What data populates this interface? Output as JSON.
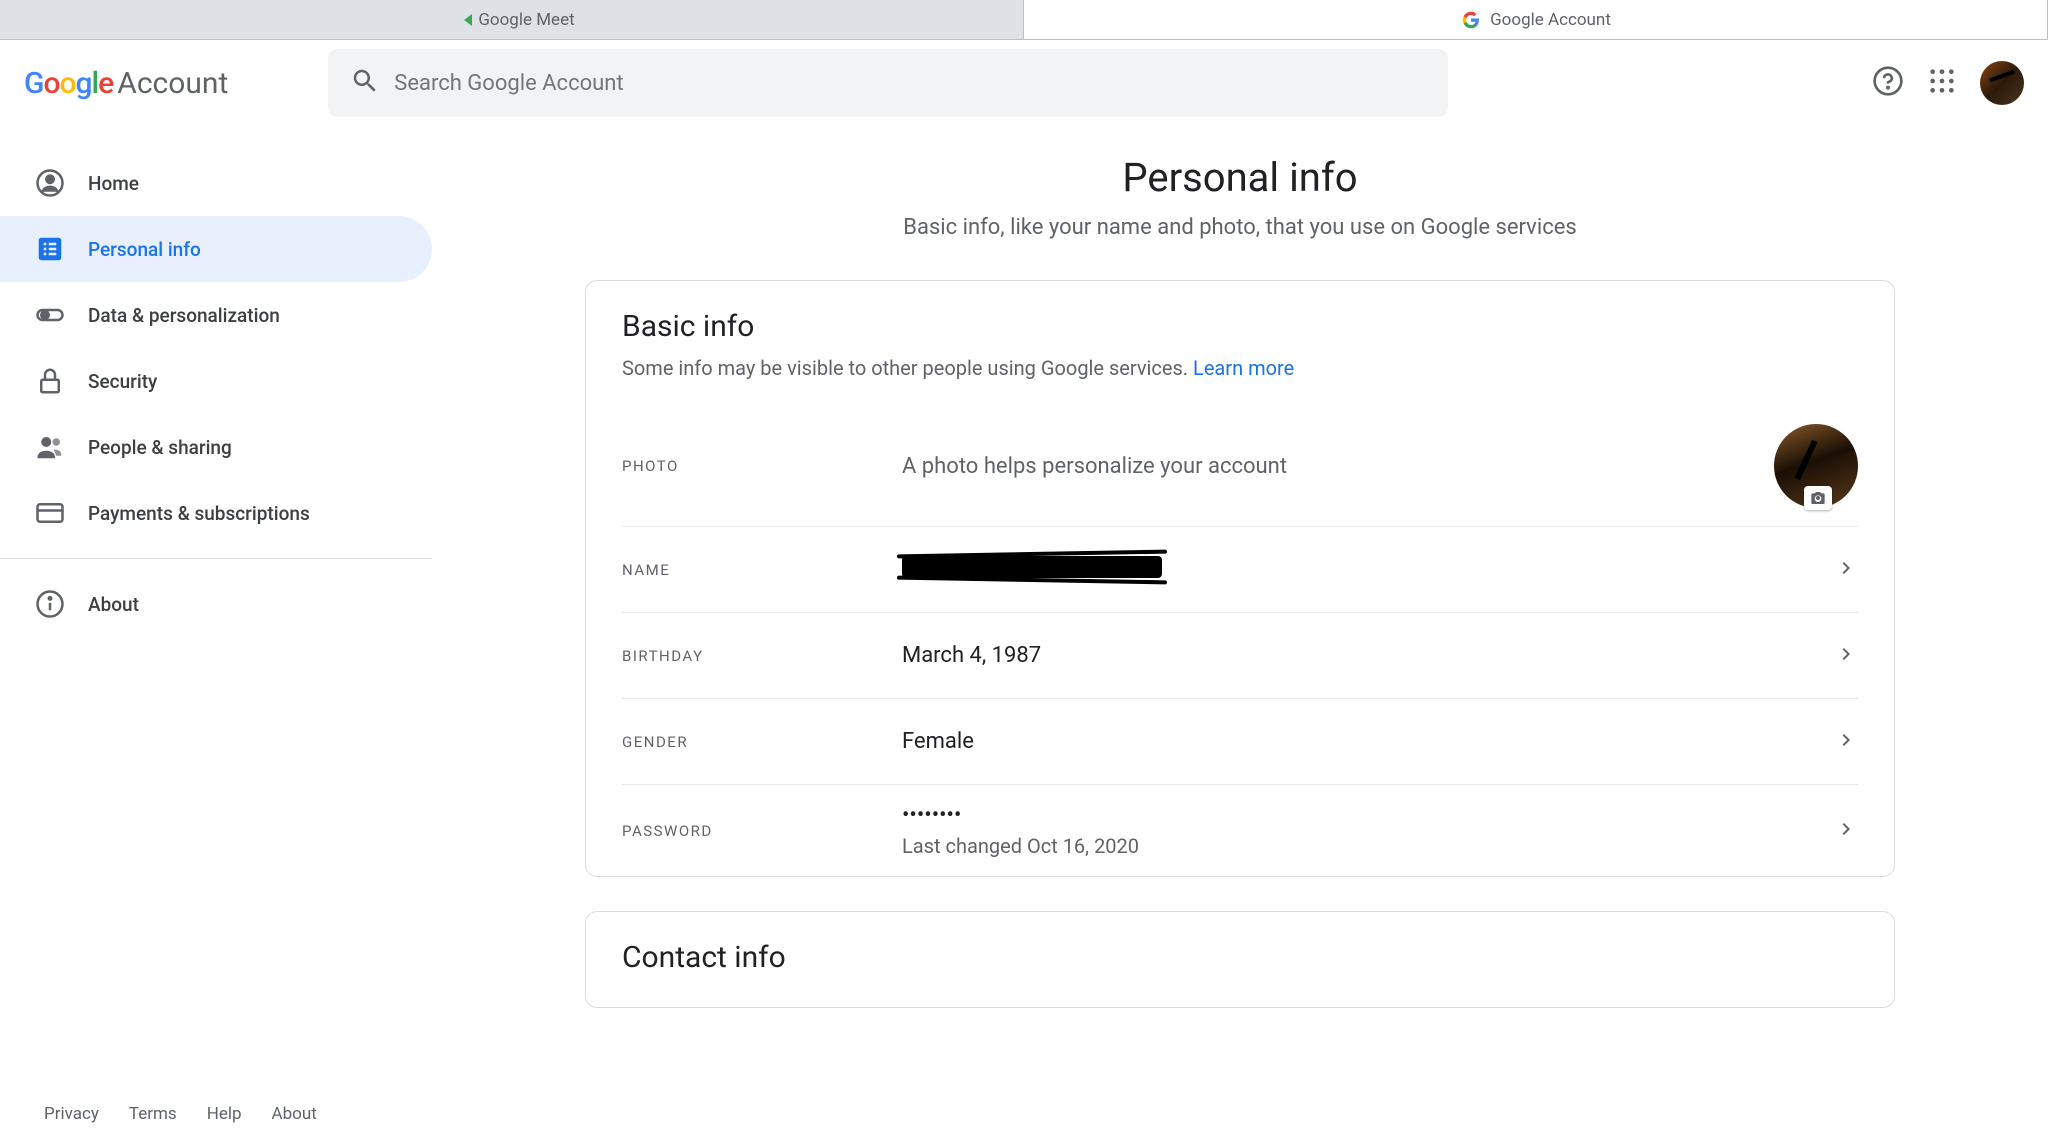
{
  "browser": {
    "tabs": [
      {
        "label": "Google Meet"
      },
      {
        "label": "Google Account"
      }
    ]
  },
  "header": {
    "logo_account": "Account",
    "search_placeholder": "Search Google Account"
  },
  "sidebar": {
    "items": [
      {
        "label": "Home"
      },
      {
        "label": "Personal info"
      },
      {
        "label": "Data & personalization"
      },
      {
        "label": "Security"
      },
      {
        "label": "People & sharing"
      },
      {
        "label": "Payments & subscriptions"
      },
      {
        "label": "About"
      }
    ]
  },
  "page": {
    "title": "Personal info",
    "subtitle": "Basic info, like your name and photo, that you use on Google services"
  },
  "basic_info": {
    "title": "Basic info",
    "desc": "Some info may be visible to other people using Google services. ",
    "learn_more": "Learn more",
    "rows": {
      "photo": {
        "label": "PHOTO",
        "value": "A photo helps personalize your account"
      },
      "name": {
        "label": "NAME"
      },
      "birthday": {
        "label": "BIRTHDAY",
        "value": "March 4, 1987"
      },
      "gender": {
        "label": "GENDER",
        "value": "Female"
      },
      "password": {
        "label": "PASSWORD",
        "value": "••••••••",
        "sub": "Last changed Oct 16, 2020"
      }
    }
  },
  "contact_info": {
    "title": "Contact info"
  },
  "footer": {
    "links": [
      {
        "label": "Privacy"
      },
      {
        "label": "Terms"
      },
      {
        "label": "Help"
      },
      {
        "label": "About"
      }
    ]
  }
}
